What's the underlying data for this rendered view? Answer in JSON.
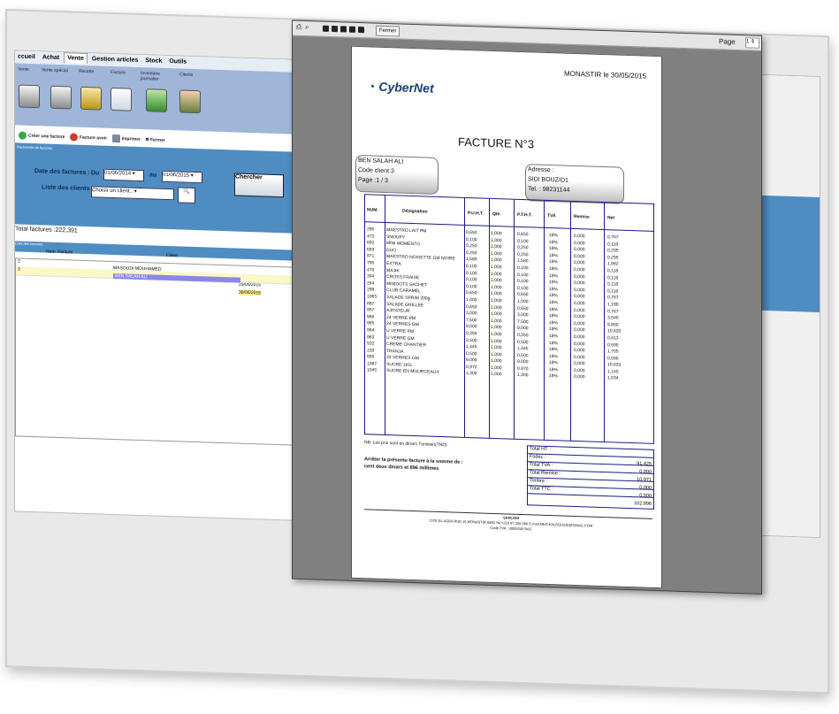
{
  "app": {
    "menu": [
      "ccueil",
      "Achat",
      "Vente",
      "Gestion articles",
      "Stock",
      "Outils"
    ],
    "ribbon": [
      "Vente",
      "Vente spécial",
      "Recette",
      "Facture",
      "Inventaire journalier",
      "Clients"
    ],
    "toolbar": [
      "Créer une facture",
      "Facture avoir",
      "Imprimer",
      "Fermer"
    ],
    "search": {
      "section": "Recherche de factures",
      "date_label": "Date des factures :",
      "du": "Du",
      "date_from": "01/06/2014",
      "au": "au",
      "date_to": "01/06/2015",
      "clients_label": "Liste des clients :",
      "clients_value": "Choisir un client..",
      "button": "Chercher"
    },
    "total": "Total factures :222,391",
    "list_header": "Liste des factures",
    "columns": [
      "Num. Facture",
      "Client"
    ],
    "rows": [
      {
        "num": "2",
        "client": "MASOUDI MOUHAMED",
        "date": "29/05/2015"
      },
      {
        "num": "3",
        "client": "BEN SALAH ALI",
        "date": "30/05/2015"
      }
    ]
  },
  "preview": {
    "fermer": "Fermer",
    "page_label": "Page",
    "page_value": "1"
  },
  "invoice": {
    "logo": "CyberNet",
    "place_date": "MONASTIR le 30/05/2015",
    "title": "FACTURE N°3",
    "client_box": [
      "BEN SALAH ALI",
      "Code client:3",
      "Page :1 / 3"
    ],
    "address_box": [
      "Adresse :",
      "SIDI BOUZID1",
      "Tel. : 98231144"
    ],
    "headers": [
      "NUM.",
      "Désignation",
      "P.U.H.T.",
      "Qte.",
      "P.T.H.T.",
      "TVA",
      "Remise",
      "Net"
    ],
    "num": [
      "295",
      "472",
      "692",
      "693",
      "871",
      "795",
      "470",
      "304",
      "264",
      "299",
      "1065",
      "887",
      "957",
      "966",
      "965",
      "964",
      "963",
      "532",
      "220",
      "955",
      "1087",
      "1045"
    ],
    "designation": [
      "MAESTRO LAIT PM",
      "SNOUPY",
      "MINI MOMENTO",
      "DUO",
      "MAESTRO NOISETTE GM NOIRE",
      "EXTRA",
      "MAJIK",
      "CROSS FRAISE",
      "MINIDOTS SACHET",
      "CLUB CARAMEL",
      "SALADE SPRIM 200g",
      "SALADE GRILLEE",
      "AJITATEUR",
      "24 VERRE PM",
      "24 VERRES GM",
      "U VERRE PM",
      "U VERRE GM",
      "CREME CHANTIER",
      "TRANJA",
      "24 VERRES GM",
      "SUCRE 1KG",
      "SUCRE EN MOURCEAUX"
    ],
    "puht": [
      "0,650",
      "0,100",
      "0,250",
      "0,250",
      "1,580",
      "0,100",
      "0,100",
      "0,100",
      "0,100",
      "0,650",
      "1,000",
      "0,650",
      "3,000",
      "7,500",
      "9,000",
      "0,350",
      "0,500",
      "1,445",
      "0,500",
      "9,000",
      "0,970",
      "1,300"
    ],
    "qte": [
      "1,000",
      "1,000",
      "1,000",
      "1,000",
      "1,000",
      "1,000",
      "1,000",
      "1,000",
      "1,000",
      "1,000",
      "1,000",
      "1,000",
      "1,000",
      "1,000",
      "1,000",
      "1,000",
      "1,000",
      "1,000",
      "1,000",
      "1,000",
      "1,000",
      "1,000"
    ],
    "ptht": [
      "0,650",
      "0,100",
      "0,250",
      "0,250",
      "1,580",
      "0,100",
      "0,100",
      "0,100",
      "0,100",
      "0,650",
      "1,000",
      "0,650",
      "3,000",
      "7,500",
      "9,000",
      "0,350",
      "0,500",
      "1,445",
      "0,500",
      "9,000",
      "0,970",
      "1,300"
    ],
    "tva": [
      "18%",
      "18%",
      "18%",
      "18%",
      "18%",
      "18%",
      "18%",
      "18%",
      "18%",
      "18%",
      "18%",
      "18%",
      "18%",
      "18%",
      "18%",
      "18%",
      "18%",
      "18%",
      "18%",
      "18%",
      "18%",
      "18%"
    ],
    "remise": [
      "0,000",
      "0,000",
      "0,000",
      "0,000",
      "0,000",
      "0,000",
      "0,000",
      "0,000",
      "0,000",
      "0,000",
      "0,000",
      "0,000",
      "0,000",
      "0,000",
      "0,000",
      "0,000",
      "0,000",
      "0,000",
      "0,000",
      "0,000",
      "0,000",
      "0,000"
    ],
    "net": [
      "0,767",
      "0,118",
      "0,295",
      "0,295",
      "1,982",
      "0,118",
      "0,118",
      "0,118",
      "0,118",
      "0,767",
      "1,180",
      "0,767",
      "3,540",
      "8,850",
      "10,620",
      "0,413",
      "0,590",
      "1,705",
      "0,590",
      "10,620",
      "1,145",
      "1,534"
    ],
    "note": "NB: Les prix sont en dinars Tunisien(TND)",
    "totals": [
      {
        "label": "Total HT. :",
        "value": ""
      },
      {
        "label": "Fodec :",
        "value": "91,425"
      },
      {
        "label": "Total TVA :",
        "value": "0,000"
      },
      {
        "label": "Total Remise :",
        "value": "10,971"
      },
      {
        "label": "Timbre :",
        "value": "0,000"
      },
      {
        "label": "Total TTC :",
        "value": "0,500"
      },
      {
        "label": "",
        "value": "102,896"
      }
    ],
    "arret": [
      "Arrêter la présente facture à la somme de :",
      "cent deux dinars et 896 millimes"
    ],
    "footer": [
      "CITE EL AGBA RUE 10 MONASTIR 5000 Tel:+216 97 236 060 E-mail:MED.KALBOUSSI@GMAIL.COM",
      "SAHLANI",
      "Code TVA : 0000/000 BAC"
    ]
  }
}
